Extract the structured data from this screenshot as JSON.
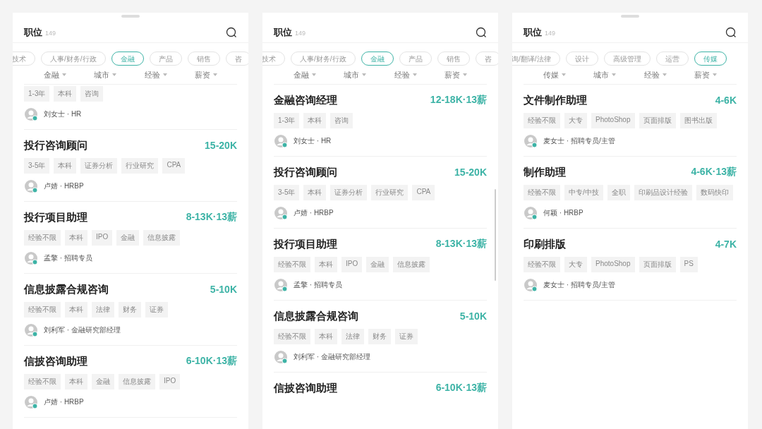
{
  "panels": [
    {
      "handle": true,
      "scrollbar": false,
      "header": {
        "title": "职位",
        "count": "149"
      },
      "categories": [
        {
          "label": "技术",
          "selected": false
        },
        {
          "label": "人事/财务/行政",
          "selected": false
        },
        {
          "label": "金融",
          "selected": true
        },
        {
          "label": "产品",
          "selected": false
        },
        {
          "label": "销售",
          "selected": false
        },
        {
          "label": "咨",
          "selected": false
        }
      ],
      "filters": [
        "金融",
        "城市",
        "经验",
        "薪资"
      ],
      "jobs": [
        {
          "tags": [
            "1-3年",
            "本科",
            "咨询"
          ],
          "recruiter": "刘女士 · HR"
        },
        {
          "title": "投行咨询顾问",
          "salary": "15-20K",
          "tags": [
            "3-5年",
            "本科",
            "证券分析",
            "行业研究",
            "CPA"
          ],
          "recruiter": "卢婧 · HRBP"
        },
        {
          "title": "投行项目助理",
          "salary": "8-13K·13薪",
          "tags": [
            "经验不限",
            "本科",
            "IPO",
            "金融",
            "信息披露"
          ],
          "recruiter": "孟擎 · 招聘专员"
        },
        {
          "title": "信息披露合规咨询",
          "salary": "5-10K",
          "tags": [
            "经验不限",
            "本科",
            "法律",
            "财务",
            "证券"
          ],
          "recruiter": "刘利军 · 金融研究部经理"
        },
        {
          "title": "信披咨询助理",
          "salary": "6-10K·13薪",
          "tags": [
            "经验不限",
            "本科",
            "金融",
            "信息披露",
            "IPO"
          ],
          "recruiter": "卢婧 · HRBP"
        }
      ]
    },
    {
      "handle": false,
      "scrollbar": true,
      "header": {
        "title": "职位",
        "count": "149"
      },
      "categories": [
        {
          "label": "技术",
          "selected": false
        },
        {
          "label": "人事/财务/行政",
          "selected": false
        },
        {
          "label": "金融",
          "selected": true
        },
        {
          "label": "产品",
          "selected": false
        },
        {
          "label": "销售",
          "selected": false
        },
        {
          "label": "咨",
          "selected": false
        }
      ],
      "filters": [
        "金融",
        "城市",
        "经验",
        "薪资"
      ],
      "jobs": [
        {
          "title": "金融咨询经理",
          "salary": "12-18K·13薪",
          "tags": [
            "1-3年",
            "本科",
            "咨询"
          ],
          "recruiter": "刘女士 · HR"
        },
        {
          "title": "投行咨询顾问",
          "salary": "15-20K",
          "tags": [
            "3-5年",
            "本科",
            "证券分析",
            "行业研究",
            "CPA"
          ],
          "recruiter": "卢婧 · HRBP"
        },
        {
          "title": "投行项目助理",
          "salary": "8-13K·13薪",
          "tags": [
            "经验不限",
            "本科",
            "IPO",
            "金融",
            "信息披露"
          ],
          "recruiter": "孟擎 · 招聘专员"
        },
        {
          "title": "信息披露合规咨询",
          "salary": "5-10K",
          "tags": [
            "经验不限",
            "本科",
            "法律",
            "财务",
            "证券"
          ],
          "recruiter": "刘利军 · 金融研究部经理"
        },
        {
          "title": "信披咨询助理",
          "salary": "6-10K·13薪"
        }
      ]
    },
    {
      "handle": true,
      "scrollbar": false,
      "header": {
        "title": "职位",
        "count": "149"
      },
      "categories": [
        {
          "label": "询/翻译/法律",
          "selected": false
        },
        {
          "label": "设计",
          "selected": false
        },
        {
          "label": "高级管理",
          "selected": false
        },
        {
          "label": "运营",
          "selected": false
        },
        {
          "label": "传媒",
          "selected": true
        }
      ],
      "filters": [
        "传媒",
        "城市",
        "经验",
        "薪资"
      ],
      "jobs": [
        {
          "title": "文件制作助理",
          "salary": "4-6K",
          "tags": [
            "经验不限",
            "大专",
            "PhotoShop",
            "页面排版",
            "图书出版"
          ],
          "recruiter": "麦女士 · 招聘专员/主管"
        },
        {
          "title": "制作助理",
          "salary": "4-6K·13薪",
          "tags": [
            "经验不限",
            "中专/中技",
            "全职",
            "印刷品设计经验",
            "数码快印"
          ],
          "recruiter": "何颖 · HRBP"
        },
        {
          "title": "印刷排版",
          "salary": "4-7K",
          "tags": [
            "经验不限",
            "大专",
            "PhotoShop",
            "页面排版",
            "PS"
          ],
          "recruiter": "麦女士 · 招聘专员/主管"
        }
      ]
    }
  ]
}
